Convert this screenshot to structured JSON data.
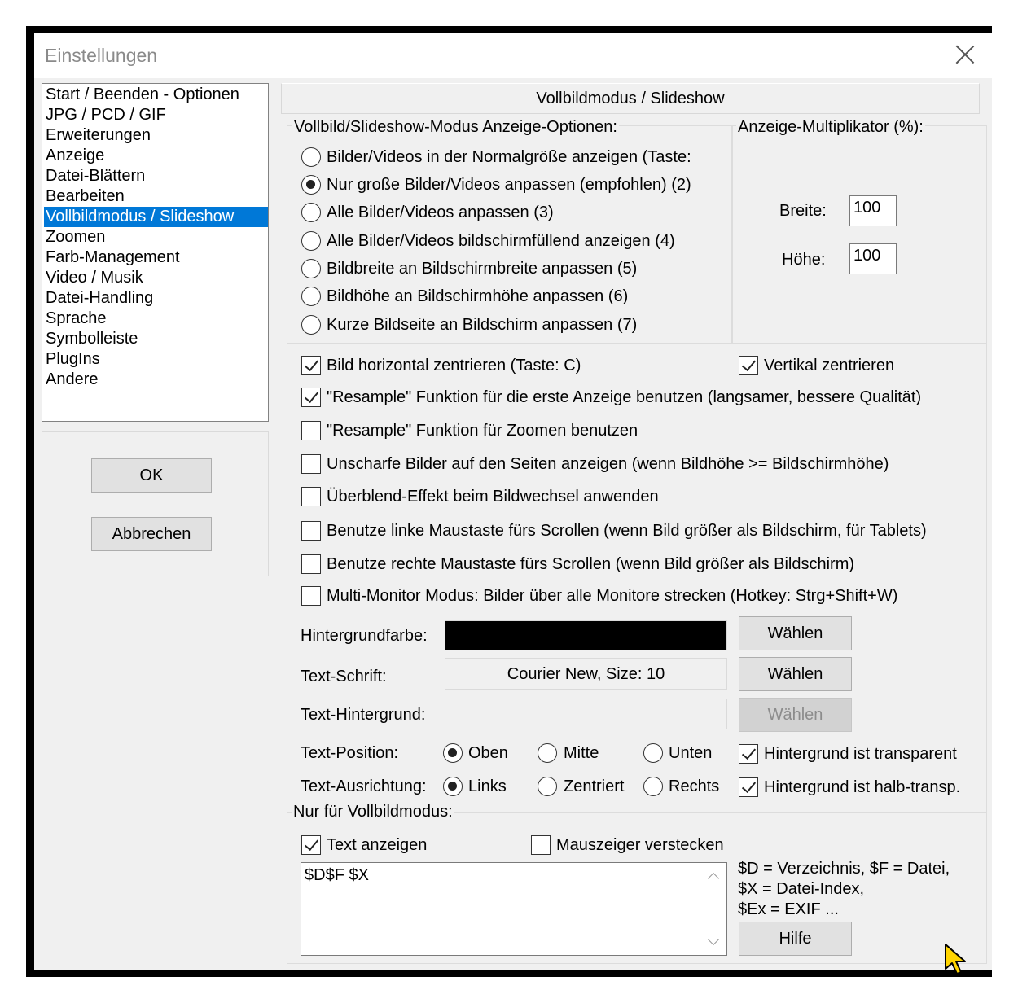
{
  "window": {
    "title": "Einstellungen"
  },
  "sidebar": {
    "items": [
      {
        "label": "Start / Beenden - Optionen"
      },
      {
        "label": "JPG / PCD / GIF"
      },
      {
        "label": "Erweiterungen"
      },
      {
        "label": "Anzeige"
      },
      {
        "label": "Datei-Blättern"
      },
      {
        "label": "Bearbeiten"
      },
      {
        "label": "Vollbildmodus / Slideshow",
        "selected": true
      },
      {
        "label": "Zoomen"
      },
      {
        "label": "Farb-Management"
      },
      {
        "label": "Video / Musik"
      },
      {
        "label": "Datei-Handling"
      },
      {
        "label": "Sprache"
      },
      {
        "label": "Symbolleiste"
      },
      {
        "label": "PlugIns"
      },
      {
        "label": "Andere"
      }
    ],
    "ok_label": "OK",
    "cancel_label": "Abbrechen"
  },
  "main": {
    "header": "Vollbildmodus / Slideshow",
    "display_options": {
      "title": "Vollbild/Slideshow-Modus Anzeige-Optionen:",
      "options": [
        {
          "label": "Bilder/Videos in der Normalgröße anzeigen (Taste: ",
          "checked": false
        },
        {
          "label": "Nur große Bilder/Videos anpassen (empfohlen) (2)",
          "checked": true
        },
        {
          "label": "Alle Bilder/Videos anpassen (3)",
          "checked": false
        },
        {
          "label": "Alle Bilder/Videos bildschirmfüllend anzeigen (4)",
          "checked": false
        },
        {
          "label": "Bildbreite an Bildschirmbreite anpassen (5)",
          "checked": false
        },
        {
          "label": "Bildhöhe an Bildschirmhöhe anpassen (6)",
          "checked": false
        },
        {
          "label": "Kurze Bildseite an Bildschirm anpassen (7)",
          "checked": false
        }
      ]
    },
    "multiplier": {
      "title": "Anzeige-Multiplikator (%):",
      "width_label": "Breite:",
      "width_value": "100",
      "height_label": "Höhe:",
      "height_value": "100"
    },
    "checkboxes": {
      "center_h": {
        "label": "Bild horizontal zentrieren (Taste: C)",
        "checked": true
      },
      "center_v": {
        "label": "Vertikal zentrieren",
        "checked": true
      },
      "resample_first": {
        "label": "\"Resample\" Funktion für die erste Anzeige benutzen (langsamer, bessere Qualität)",
        "checked": true
      },
      "resample_zoom": {
        "label": "\"Resample\" Funktion für Zoomen benutzen",
        "checked": false
      },
      "blur_sides": {
        "label": "Unscharfe Bilder auf den Seiten anzeigen (wenn Bildhöhe >= Bildschirmhöhe)",
        "checked": false
      },
      "fade": {
        "label": "Überblend-Effekt beim Bildwechsel anwenden",
        "checked": false
      },
      "left_scroll": {
        "label": "Benutze linke Maustaste fürs Scrollen (wenn Bild größer als Bildschirm, für Tablets)",
        "checked": false
      },
      "right_scroll": {
        "label": "Benutze rechte Maustaste fürs Scrollen (wenn Bild größer als Bildschirm)",
        "checked": false
      },
      "multi_monitor": {
        "label": "Multi-Monitor Modus: Bilder über alle Monitore strecken (Hotkey: Strg+Shift+W)",
        "checked": false
      }
    },
    "background_color": {
      "label": "Hintergrundfarbe:",
      "color": "#000000",
      "button": "Wählen"
    },
    "text_font": {
      "label": "Text-Schrift:",
      "value": "Courier New, Size: 10",
      "button": "Wählen"
    },
    "text_background": {
      "label": "Text-Hintergrund:",
      "button": "Wählen",
      "button_disabled": true
    },
    "text_position": {
      "label": "Text-Position:",
      "options": [
        {
          "label": "Oben",
          "checked": true
        },
        {
          "label": "Mitte",
          "checked": false
        },
        {
          "label": "Unten",
          "checked": false
        }
      ],
      "transparent": {
        "label": "Hintergrund ist transparent",
        "checked": true
      }
    },
    "text_alignment": {
      "label": "Text-Ausrichtung:",
      "options": [
        {
          "label": "Links",
          "checked": true
        },
        {
          "label": "Zentriert",
          "checked": false
        },
        {
          "label": "Rechts",
          "checked": false
        }
      ],
      "semi_transparent": {
        "label": "Hintergrund ist halb-transp.",
        "checked": true
      }
    },
    "fullscreen_only": {
      "title": "Nur für Vollbildmodus:",
      "show_text": {
        "label": "Text anzeigen",
        "checked": true
      },
      "hide_cursor": {
        "label": "Mauszeiger verstecken",
        "checked": false
      },
      "text_value": "$D$F $X",
      "help_line1": "$D = Verzeichnis, $F = Datei,",
      "help_line2": "$X = Datei-Index,",
      "help_line3": "$Ex = EXIF ...",
      "help_button": "Hilfe"
    }
  },
  "colors": {
    "selection": "#0078d7",
    "dialog_bg": "#f0f0f0",
    "button_bg": "#e1e1e1"
  }
}
